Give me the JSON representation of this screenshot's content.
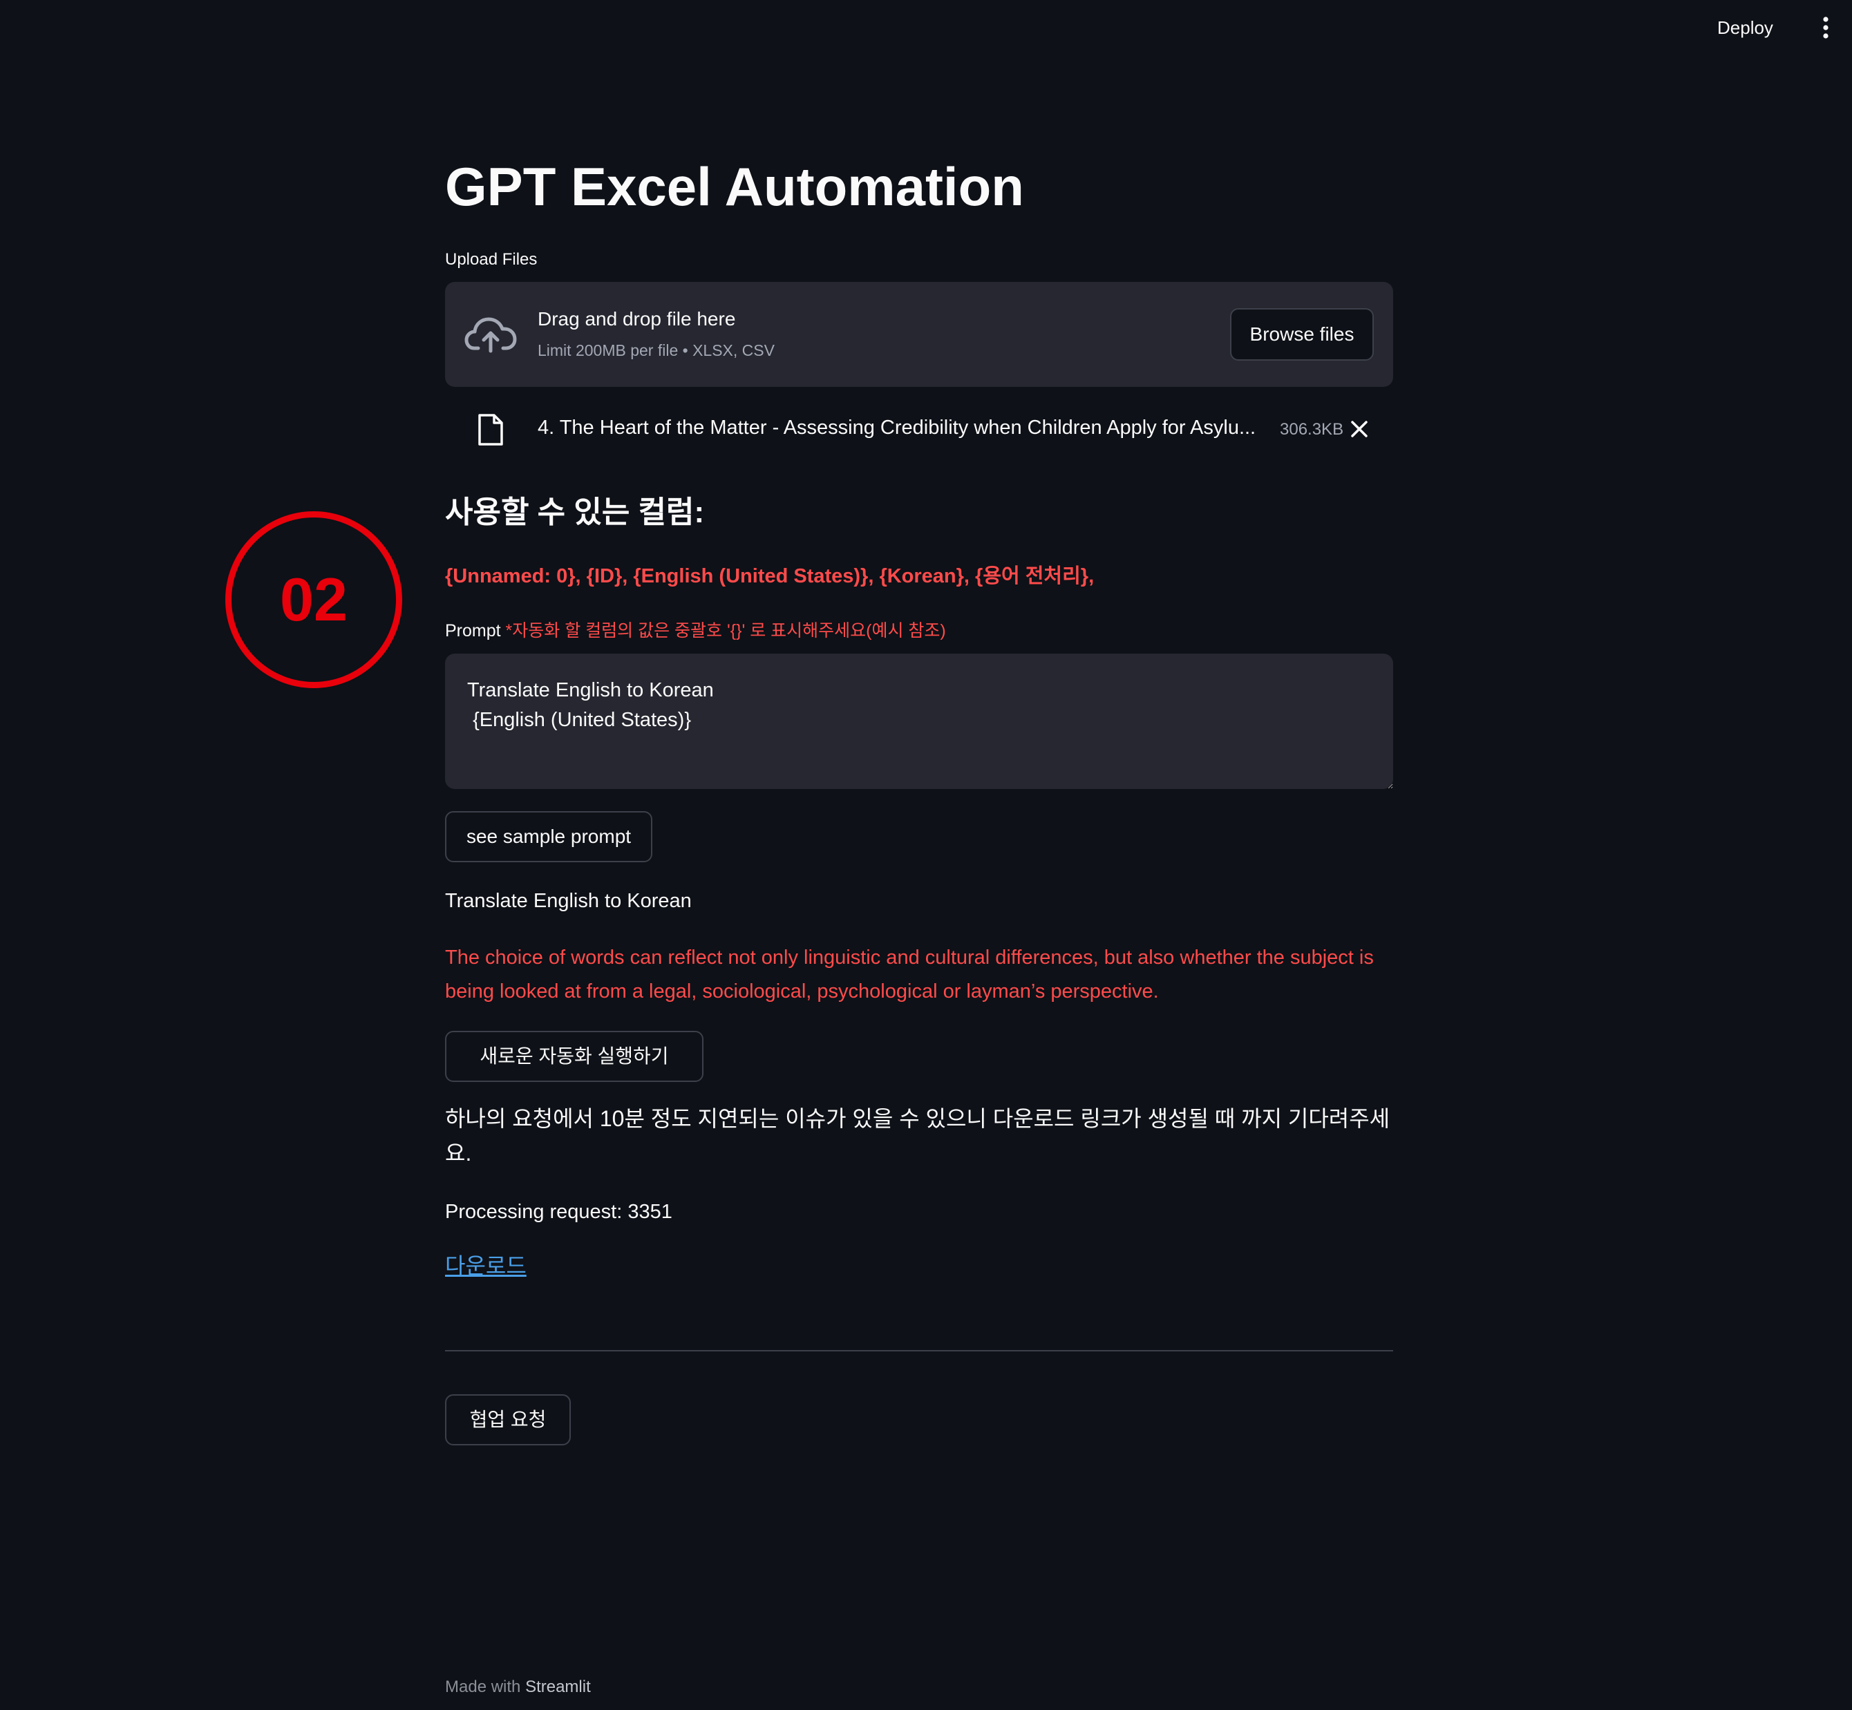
{
  "header": {
    "deploy_label": "Deploy",
    "menu_icon": "vertical-ellipsis-icon"
  },
  "main": {
    "title": "GPT Excel Automation",
    "upload": {
      "label": "Upload Files",
      "drop_title": "Drag and drop file here",
      "drop_limit": "Limit 200MB per file • XLSX, CSV",
      "browse_label": "Browse files",
      "file": {
        "name": "4. The Heart of the Matter - Assessing Credibility when Children Apply for Asylu...",
        "size": "306.3KB"
      }
    },
    "columns": {
      "heading": "사용할 수 있는 컬럼:",
      "list": "{Unnamed: 0}, {ID}, {English (United States)}, {Korean}, {용어 전처리},"
    },
    "prompt": {
      "label": "Prompt",
      "hint": "*자동화 할 컬럼의 값은 중괄호 '{}' 로 표시해주세요(예시 참조)",
      "value": "Translate English to Korean\n {English (United States)}"
    },
    "sample_button": "see sample prompt",
    "sample_title": "Translate English to Korean",
    "sample_text": "The choice of words can reflect not only linguistic and cultural differences, but also whether the subject is being looked at from a legal, sociological, psychological or layman’s perspective.",
    "run_button": "새로운 자동화 실행하기",
    "notice": "하나의 요청에서 10분 정도 지연되는 이슈가 있을 수 있으니 다운로드 링크가 생성될 때 까지 기다려주세요.",
    "processing": "Processing request: 3351",
    "download_link": "다운로드",
    "collab_button": "협업 요청"
  },
  "footer": {
    "prefix": "Made with",
    "brand": "Streamlit"
  },
  "annotation": {
    "label": "02",
    "color": "#e8000b"
  },
  "colors": {
    "background": "#0e1117",
    "panel": "#262730",
    "accent_red": "#ff4b4b",
    "link_blue": "#4a9fe8"
  }
}
